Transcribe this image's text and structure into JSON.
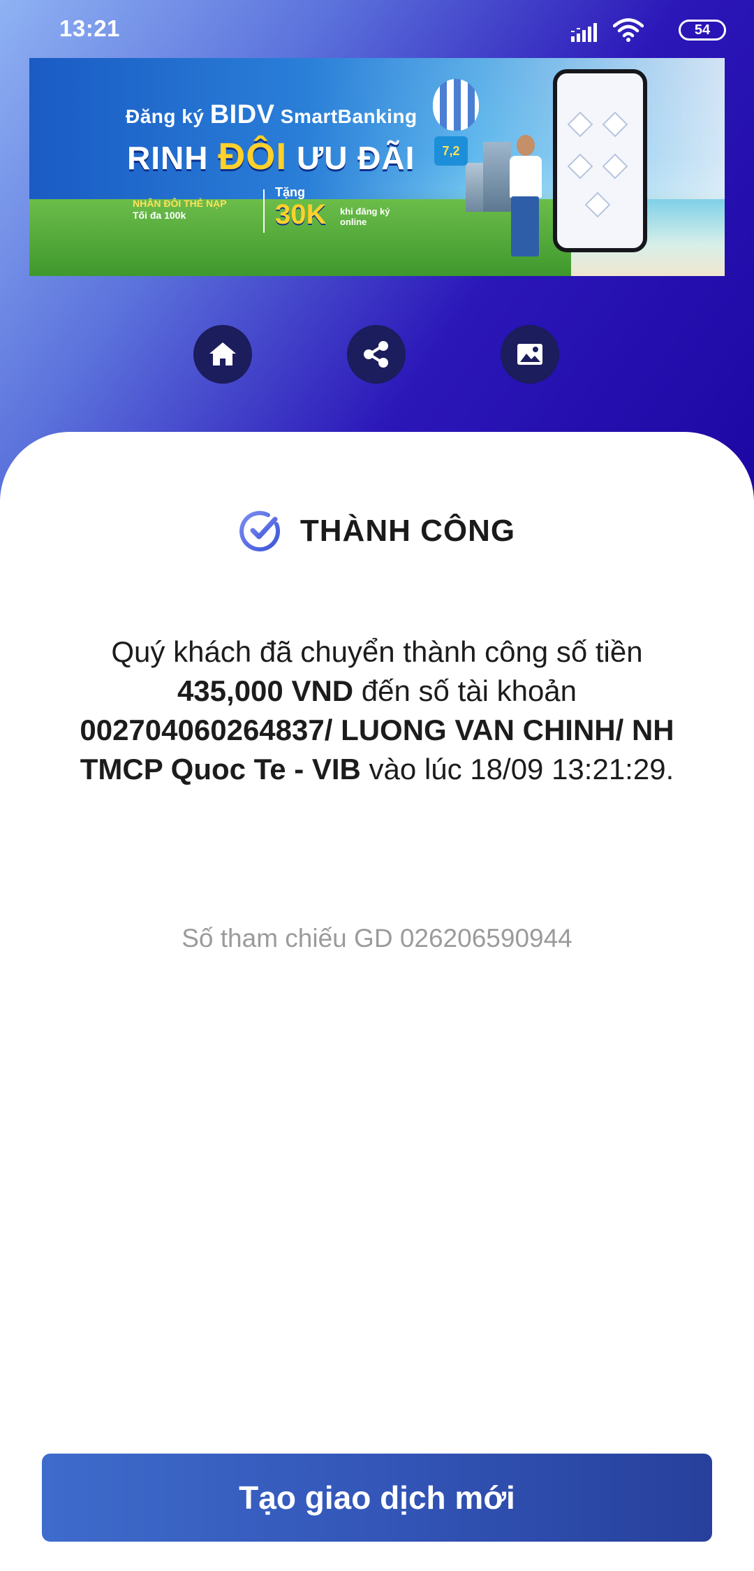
{
  "status_bar": {
    "time": "13:21",
    "battery": "54",
    "icons": [
      "signal-icon",
      "wifi-icon",
      "battery-icon"
    ]
  },
  "banner": {
    "line1_prefix": "Đăng ký",
    "line1_brand": "BIDV",
    "line1_suffix": "SmartBanking",
    "line2_a": "RINH",
    "line2_hl": "ĐÔI",
    "line2_b": "ƯU ĐÃI",
    "badge_top": "NHÂN ĐÔI THẺ NẠP",
    "badge_bottom": "Tối đa 100k",
    "gift_label": "Tặng",
    "gift_amount": "30K",
    "gift_note_1": "khi đăng ký",
    "gift_note_2": "online",
    "balloon_text": "7,2"
  },
  "actions": [
    {
      "name": "home-button",
      "icon": "home-icon"
    },
    {
      "name": "share-button",
      "icon": "share-icon"
    },
    {
      "name": "save-image-button",
      "icon": "image-icon"
    }
  ],
  "result": {
    "title": "THÀNH CÔNG",
    "msg_1": "Quý khách đã chuyển thành công số tiền ",
    "amount": "435,000 VND",
    "msg_2": " đến số tài khoản ",
    "account": "002704060264837/ LUONG VAN CHINH/ NH TMCP Quoc Te - VIB",
    "msg_3": " vào lúc 18/09 13:21:29.",
    "reference": "Số tham chiếu GD 026206590944"
  },
  "footer": {
    "new_transaction_label": "Tạo giao dịch mới"
  },
  "colors": {
    "gradient_start": "#8fb2f3",
    "gradient_end": "#1d07a3",
    "icon_button_bg": "#1b1d5c",
    "check_color": "#5b6fe0",
    "button_start": "#3e6ccc",
    "button_end": "#27409c",
    "reference_text": "#9b9b9b"
  }
}
